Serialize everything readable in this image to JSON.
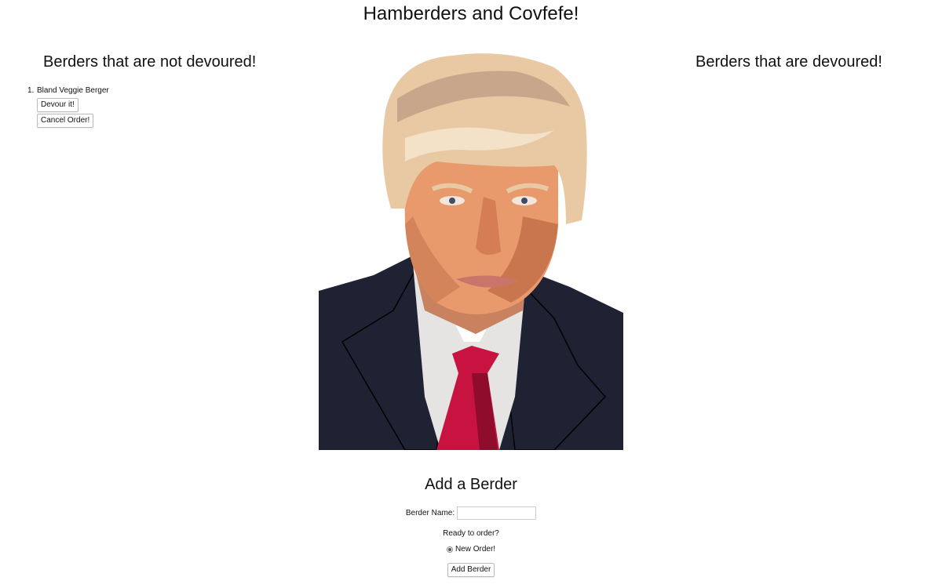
{
  "page": {
    "title": "Hamberders and Covfefe!"
  },
  "undevoured": {
    "heading": "Berders that are not devoured!",
    "items": [
      {
        "number": "1.",
        "name": "Bland Veggie Berger",
        "devour_label": "Devour it!",
        "cancel_label": "Cancel Order!"
      }
    ]
  },
  "devoured": {
    "heading": "Berders that are devoured!"
  },
  "add_form": {
    "heading": "Add a Berder",
    "name_label": "Berder Name:",
    "name_value": "",
    "ready_label": "Ready to order?",
    "radio_label": "New Order!",
    "submit_label": "Add Berder"
  },
  "colors": {
    "suit": "#1f2233",
    "tie": "#c8123f",
    "skin": "#e89a6c",
    "hair": "#e8c9a4",
    "shirt": "#e6e3e3"
  }
}
